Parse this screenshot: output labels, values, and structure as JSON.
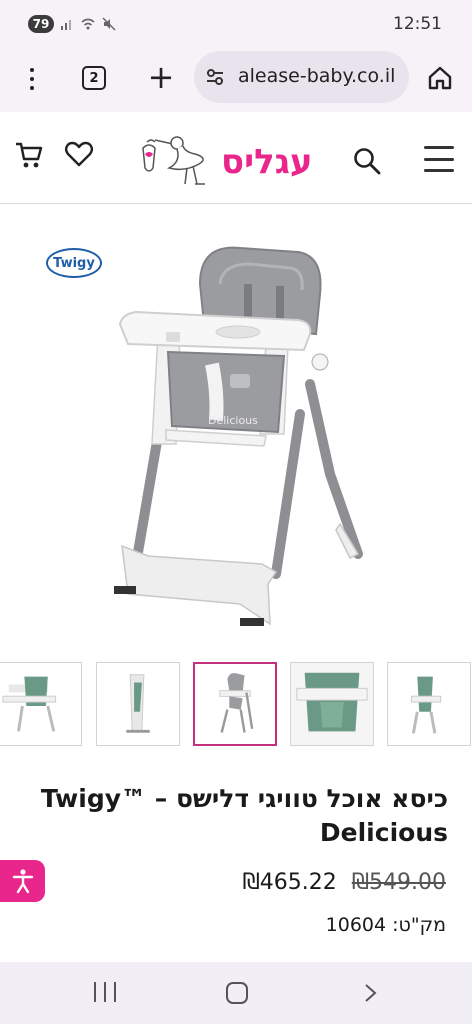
{
  "status": {
    "battery": "79",
    "time": "12:51"
  },
  "browser": {
    "tab_count": "2",
    "url": "alease-baby.co.il"
  },
  "header": {
    "logo_text": "עגליס"
  },
  "product": {
    "badge": "Twigy",
    "title": "כיסא אוכל טוויגי דלישס – Twigy™ Delicious",
    "price_old": "₪549.00",
    "price_new": "₪465.22",
    "sku": "מק\"ט: 10604",
    "chair_label": "Delicious"
  },
  "icons": {
    "cart": "cart-icon",
    "heart": "heart-icon",
    "search": "search-icon",
    "menu": "menu-icon",
    "accessibility": "accessibility-icon"
  },
  "colors": {
    "brand_pink": "#e8268c",
    "thumb_active": "#c2307e",
    "seat_gray": "#9a9c9f",
    "seat_green": "#6a9a86"
  }
}
